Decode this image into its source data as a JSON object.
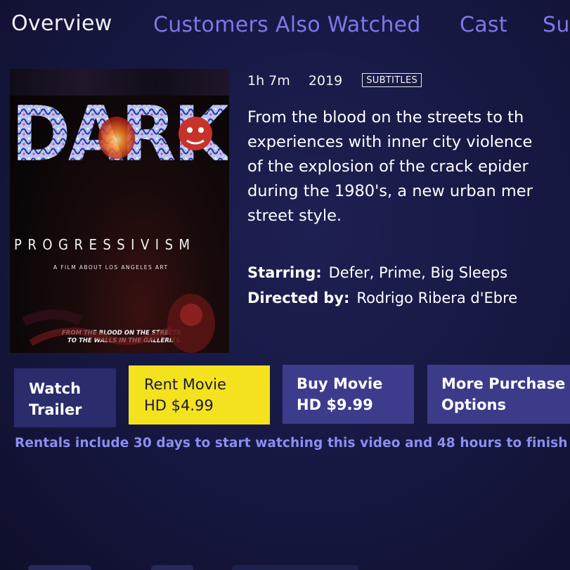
{
  "tabs": [
    {
      "label": "Overview",
      "active": true
    },
    {
      "label": "Customers Also Watched",
      "active": false
    },
    {
      "label": "Cast",
      "active": false
    },
    {
      "label": "Su",
      "active": false
    }
  ],
  "poster": {
    "title_main": "DARK",
    "title_sub": "PROGRESSIVISM",
    "subtitle": "A FILM ABOUT LOS ANGELES ART",
    "tagline_line1": "FROM THE BLOOD ON THE STREETS",
    "tagline_line2": "TO THE WALLS IN THE GALLERIES."
  },
  "meta": {
    "duration": "1h 7m",
    "year": "2019",
    "badge": "SUBTITLES"
  },
  "synopsis_lines": [
    "From the blood on the streets to th",
    "experiences with inner city violence",
    "of the explosion of the crack epider",
    "during the 1980's, a new urban mer",
    "street style."
  ],
  "credits": {
    "starring_label": "Starring:",
    "starring_value": "Defer, Prime, Big Sleeps",
    "directed_label": "Directed by:",
    "directed_value": "Rodrigo Ribera d'Ebre"
  },
  "buttons": {
    "trailer": {
      "line1": "Watch",
      "line2": "Trailer"
    },
    "rent": {
      "line1": "Rent Movie",
      "line2": "HD $4.99"
    },
    "buy": {
      "line1": "Buy Movie",
      "line2": "HD $9.99"
    },
    "more": {
      "line1": "More Purchase",
      "line2": "Options"
    }
  },
  "rental_note": "Rentals include 30 days to start watching this video and 48 hours to finish",
  "colors": {
    "background": "#171944",
    "tab_inactive": "#7c78e8",
    "rent_button": "#f5e21e",
    "secondary_button": "#3d3c8c",
    "note_text": "#8c8ef0"
  }
}
